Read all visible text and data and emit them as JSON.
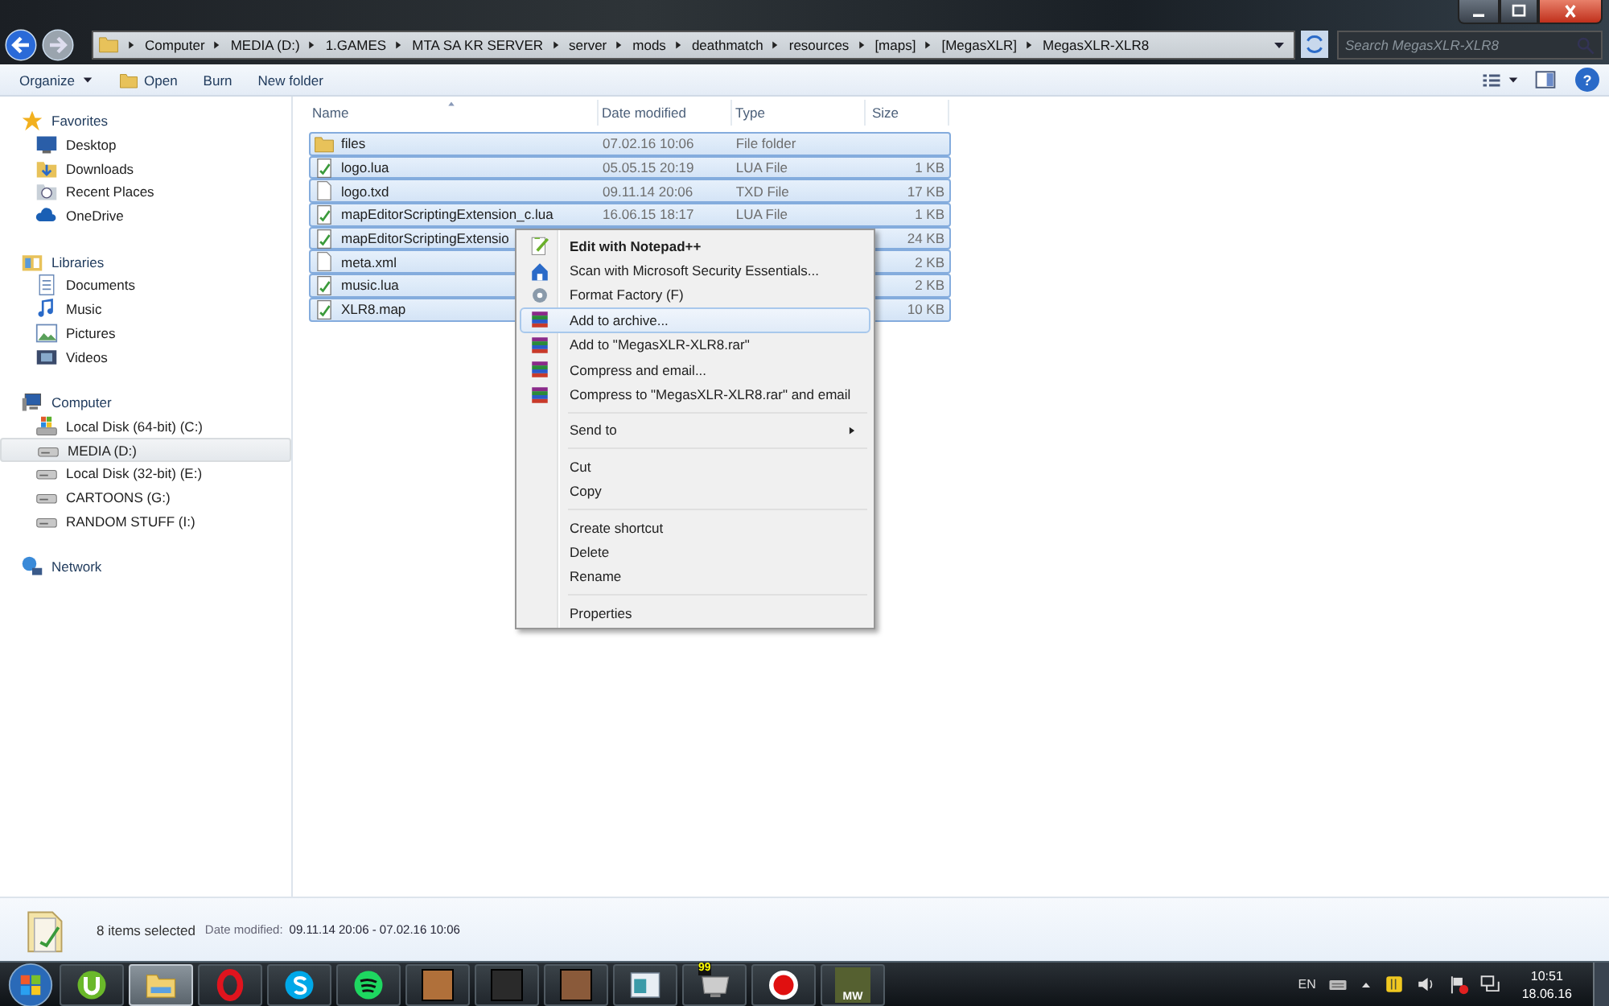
{
  "address_bar": {
    "segments": [
      "Computer",
      "MEDIA (D:)",
      "1.GAMES",
      "MTA SA KR SERVER",
      "server",
      "mods",
      "deathmatch",
      "resources",
      "[maps]",
      "[MegasXLR]",
      "MegasXLR-XLR8"
    ]
  },
  "search": {
    "placeholder": "Search MegasXLR-XLR8"
  },
  "toolbar": {
    "buttons": [
      {
        "label": "Organize",
        "kind": "menu"
      },
      {
        "label": "Open",
        "kind": "icon"
      },
      {
        "label": "Burn",
        "kind": "plain"
      },
      {
        "label": "New folder",
        "kind": "plain"
      }
    ],
    "help": "?"
  },
  "sidebar": {
    "sections": [
      {
        "label": "Favorites",
        "kind": "star",
        "selected": false,
        "children": [
          {
            "label": "Desktop",
            "kind": "desktop",
            "selected": false
          },
          {
            "label": "Downloads",
            "kind": "downloads",
            "selected": false
          },
          {
            "label": "Recent Places",
            "kind": "recent",
            "selected": false
          },
          {
            "label": "OneDrive",
            "kind": "cloud",
            "selected": false
          }
        ]
      },
      {
        "label": "Libraries",
        "kind": "library",
        "selected": false,
        "children": [
          {
            "label": "Documents",
            "kind": "document",
            "selected": false
          },
          {
            "label": "Music",
            "kind": "music",
            "selected": false
          },
          {
            "label": "Pictures",
            "kind": "pictures",
            "selected": false
          },
          {
            "label": "Videos",
            "kind": "videos",
            "selected": false
          }
        ]
      },
      {
        "label": "Computer",
        "kind": "computer",
        "selected": false,
        "children": [
          {
            "label": "Local Disk (64-bit) (C:)",
            "kind": "system-drive",
            "selected": false
          },
          {
            "label": "MEDIA (D:)",
            "kind": "drive",
            "selected": true
          },
          {
            "label": "Local Disk (32-bit) (E:)",
            "kind": "drive",
            "selected": false
          },
          {
            "label": "CARTOONS (G:)",
            "kind": "drive",
            "selected": false
          },
          {
            "label": "RANDOM STUFF (I:)",
            "kind": "drive",
            "selected": false
          }
        ]
      },
      {
        "label": "Network",
        "kind": "network",
        "selected": false
      }
    ]
  },
  "table": {
    "columns": [
      "Name",
      "Date modified",
      "Type",
      "Size"
    ],
    "rows": [
      {
        "name": "files",
        "date": "07.02.16 10:06",
        "type": "File folder",
        "kind": "folder",
        "selected": true
      },
      {
        "name": "logo.lua",
        "date": "05.05.15 20:19",
        "type": "LUA File",
        "size": "1 KB",
        "kind": "script",
        "selected": true
      },
      {
        "name": "logo.txd",
        "date": "09.11.14 20:06",
        "type": "TXD File",
        "size": "17 KB",
        "kind": "file",
        "selected": true
      },
      {
        "name": "mapEditorScriptingExtension_c.lua",
        "date": "16.06.15 18:17",
        "type": "LUA File",
        "size": "1 KB",
        "kind": "script",
        "selected": true
      },
      {
        "name": "mapEditorScriptingExtensio",
        "size": "24 KB",
        "kind": "script",
        "selected": true
      },
      {
        "name": "meta.xml",
        "size": "2 KB",
        "kind": "file",
        "selected": true
      },
      {
        "name": "music.lua",
        "size": "2 KB",
        "kind": "script",
        "selected": true
      },
      {
        "name": "XLR8.map",
        "size": "10 KB",
        "kind": "script",
        "selected": true
      }
    ]
  },
  "context_menu": {
    "groups": [
      [
        {
          "label": "Edit with Notepad++",
          "kind": "notepad",
          "default": true,
          "selected": false,
          "submenu": false
        },
        {
          "label": "Scan with Microsoft Security Essentials...",
          "kind": "house",
          "default": false,
          "selected": false,
          "submenu": false
        },
        {
          "label": "Format Factory (F)",
          "kind": "gear",
          "default": false,
          "selected": false,
          "submenu": false
        },
        {
          "label": "Add to archive...",
          "kind": "archive",
          "default": false,
          "selected": true,
          "submenu": false
        },
        {
          "label": "Add to \"MegasXLR-XLR8.rar\"",
          "kind": "archive",
          "default": false,
          "selected": false,
          "submenu": false
        },
        {
          "label": "Compress and email...",
          "kind": "archive",
          "default": false,
          "selected": false,
          "submenu": false
        },
        {
          "label": "Compress to \"MegasXLR-XLR8.rar\" and email",
          "kind": "archive",
          "default": false,
          "selected": false,
          "submenu": false
        }
      ],
      [
        {
          "label": "Send to",
          "default": false,
          "selected": false,
          "submenu": true
        }
      ],
      [
        {
          "label": "Cut",
          "default": false,
          "selected": false,
          "submenu": false
        },
        {
          "label": "Copy",
          "default": false,
          "selected": false,
          "submenu": false
        }
      ],
      [
        {
          "label": "Create shortcut",
          "default": false,
          "selected": false,
          "submenu": false
        },
        {
          "label": "Delete",
          "default": false,
          "selected": false,
          "submenu": false
        },
        {
          "label": "Rename",
          "default": false,
          "selected": false,
          "submenu": false
        }
      ],
      [
        {
          "label": "Properties",
          "default": false,
          "selected": false,
          "submenu": false
        }
      ]
    ]
  },
  "status_bar": {
    "count": "8 items selected",
    "date_label": "Date modified:",
    "date_range": "09.11.14 20:06 - 07.02.16 10:06"
  },
  "taskbar": {
    "items": [
      {
        "kind": "torrent",
        "active": false
      },
      {
        "kind": "folder",
        "active": true
      },
      {
        "kind": "browser",
        "active": false
      },
      {
        "kind": "chat",
        "active": false
      },
      {
        "kind": "music",
        "active": false
      },
      {
        "kind": "game-art",
        "active": false,
        "color": "#b0703a"
      },
      {
        "kind": "game-art",
        "active": false,
        "color": "#2a2a2a"
      },
      {
        "kind": "game-art",
        "active": false,
        "color": "#8a5a3a"
      },
      {
        "kind": "window",
        "active": false
      },
      {
        "kind": "monitor",
        "active": false,
        "badge": "99"
      },
      {
        "kind": "record",
        "active": false
      },
      {
        "kind": "game-logo",
        "active": false,
        "label": "MW"
      }
    ]
  },
  "tray": {
    "language": "EN",
    "time": "10:51",
    "date": "18.06.16"
  }
}
